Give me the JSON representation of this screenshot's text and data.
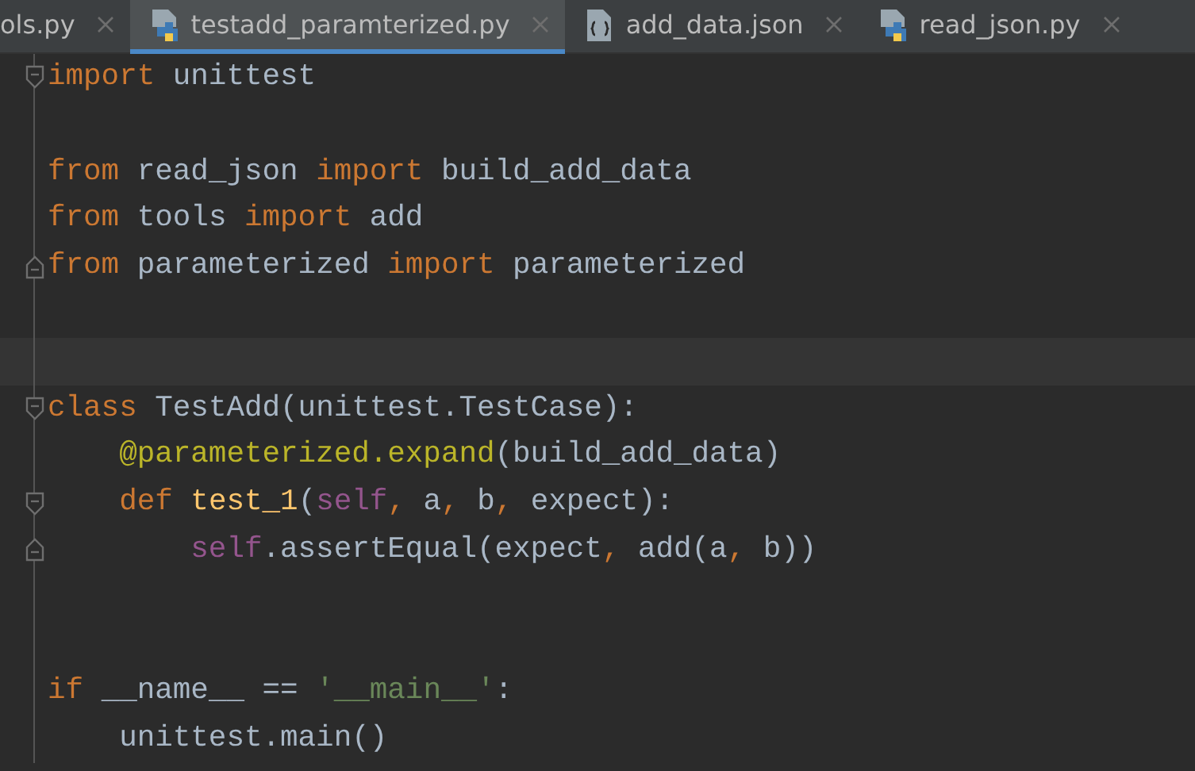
{
  "tabs": [
    {
      "label": "ols.py",
      "kind": "none",
      "selected": false
    },
    {
      "label": "testadd_paramterized.py",
      "kind": "python",
      "selected": true
    },
    {
      "label": "add_data.json",
      "kind": "json",
      "selected": false
    },
    {
      "label": "read_json.py",
      "kind": "python",
      "selected": false
    }
  ],
  "editor": {
    "lines": [
      {
        "kind": "fold-start",
        "tokens": [
          {
            "text": "import",
            "kind": "keyword"
          },
          {
            "text": " unittest",
            "kind": "plain"
          }
        ]
      },
      {
        "kind": "plain"
      },
      {
        "kind": "plain",
        "tokens": [
          {
            "text": "from",
            "kind": "keyword"
          },
          {
            "text": " read_json ",
            "kind": "plain"
          },
          {
            "text": "import",
            "kind": "keyword"
          },
          {
            "text": " build_add_data",
            "kind": "plain"
          }
        ]
      },
      {
        "kind": "plain",
        "tokens": [
          {
            "text": "from",
            "kind": "keyword"
          },
          {
            "text": " tools ",
            "kind": "plain"
          },
          {
            "text": "import",
            "kind": "keyword"
          },
          {
            "text": " add",
            "kind": "plain"
          }
        ]
      },
      {
        "kind": "fold-end",
        "tokens": [
          {
            "text": "from",
            "kind": "keyword"
          },
          {
            "text": " parameterized ",
            "kind": "plain"
          },
          {
            "text": "import",
            "kind": "keyword"
          },
          {
            "text": " parameterized",
            "kind": "plain"
          }
        ]
      },
      {
        "kind": "plain"
      },
      {
        "kind": "caret-line"
      },
      {
        "kind": "fold-start",
        "tokens": [
          {
            "text": "class",
            "kind": "keyword"
          },
          {
            "text": " TestAdd(unittest.TestCase):",
            "kind": "plain"
          }
        ]
      },
      {
        "kind": "plain",
        "tokens": [
          {
            "text": "    @parameterized.expand",
            "kind": "decorator"
          },
          {
            "text": "(build_add_data)",
            "kind": "plain"
          }
        ]
      },
      {
        "kind": "fold-start",
        "tokens": [
          {
            "text": "    def",
            "kind": "keyword"
          },
          {
            "text": " test_1",
            "kind": "function"
          },
          {
            "text": "(",
            "kind": "plain"
          },
          {
            "text": "self",
            "kind": "self"
          },
          {
            "text": ",",
            "kind": "comma"
          },
          {
            "text": " a",
            "kind": "plain"
          },
          {
            "text": ",",
            "kind": "comma"
          },
          {
            "text": " b",
            "kind": "plain"
          },
          {
            "text": ",",
            "kind": "comma"
          },
          {
            "text": " expect):",
            "kind": "plain"
          }
        ]
      },
      {
        "kind": "fold-end",
        "tokens": [
          {
            "text": "        self",
            "kind": "self"
          },
          {
            "text": ".assertEqual(expect",
            "kind": "plain"
          },
          {
            "text": ",",
            "kind": "comma"
          },
          {
            "text": " add(a",
            "kind": "plain"
          },
          {
            "text": ",",
            "kind": "comma"
          },
          {
            "text": " b))",
            "kind": "plain"
          }
        ]
      },
      {
        "kind": "plain"
      },
      {
        "kind": "plain"
      },
      {
        "kind": "plain",
        "tokens": [
          {
            "text": "if",
            "kind": "keyword"
          },
          {
            "text": " __name__ == ",
            "kind": "plain"
          },
          {
            "text": "'__main__'",
            "kind": "string"
          },
          {
            "text": ":",
            "kind": "plain"
          }
        ]
      },
      {
        "kind": "plain",
        "tokens": [
          {
            "text": "    unittest.main()",
            "kind": "plain"
          }
        ]
      }
    ]
  }
}
